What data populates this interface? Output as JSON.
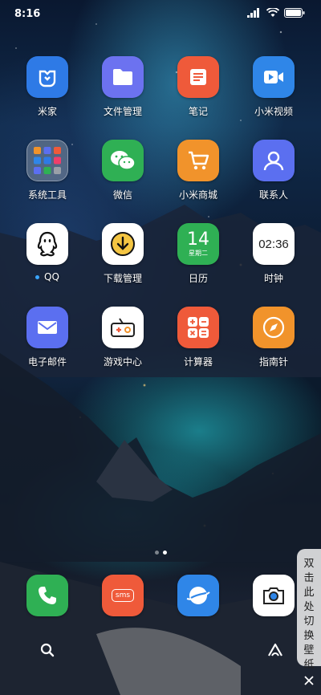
{
  "status_bar": {
    "time": "8:16",
    "icons": [
      "signal-icon",
      "wifi-icon",
      "battery-icon"
    ]
  },
  "apps": [
    {
      "label": "米家",
      "icon": "mijia-icon",
      "color": "#2e7ae6"
    },
    {
      "label": "文件管理",
      "icon": "folder-icon",
      "color": "#6c72f0"
    },
    {
      "label": "笔记",
      "icon": "notes-icon",
      "color": "#ef5a3a"
    },
    {
      "label": "小米视频",
      "icon": "video-icon",
      "color": "#2f86e8"
    },
    {
      "label": "系统工具",
      "icon": "folder-tools-icon",
      "color": "#ffffff"
    },
    {
      "label": "微信",
      "icon": "wechat-icon",
      "color": "#2fb054"
    },
    {
      "label": "小米商城",
      "icon": "cart-icon",
      "color": "#f1932b"
    },
    {
      "label": "联系人",
      "icon": "contacts-icon",
      "color": "#5b6ff0"
    },
    {
      "label": "QQ",
      "icon": "qq-icon",
      "color": "#ffffff"
    },
    {
      "label": "下载管理",
      "icon": "download-icon",
      "color": "#ffffff"
    },
    {
      "label": "日历",
      "icon": "calendar-icon",
      "color": "#2fb054",
      "day": "14",
      "weekday": "星期二"
    },
    {
      "label": "时钟",
      "icon": "clock-icon",
      "color": "#ffffff",
      "time": "02:36"
    },
    {
      "label": "电子邮件",
      "icon": "mail-icon",
      "color": "#5b6ff0"
    },
    {
      "label": "游戏中心",
      "icon": "gamepad-icon",
      "color": "#ffffff"
    },
    {
      "label": "计算器",
      "icon": "calculator-icon",
      "color": "#ef5a3a"
    },
    {
      "label": "指南针",
      "icon": "compass-icon",
      "color": "#f1932b"
    }
  ],
  "dock": [
    {
      "name": "phone-icon",
      "color": "#2fb054"
    },
    {
      "name": "sms-icon",
      "color": "#ef5a3a",
      "text": "sms"
    },
    {
      "name": "browser-icon",
      "color": "#2f86e8"
    },
    {
      "name": "camera-icon",
      "color": "#ffffff"
    }
  ],
  "wallpaper_switch": {
    "chars": [
      "双",
      "击",
      "此",
      "处",
      "切",
      "换",
      "壁",
      "纸"
    ]
  }
}
